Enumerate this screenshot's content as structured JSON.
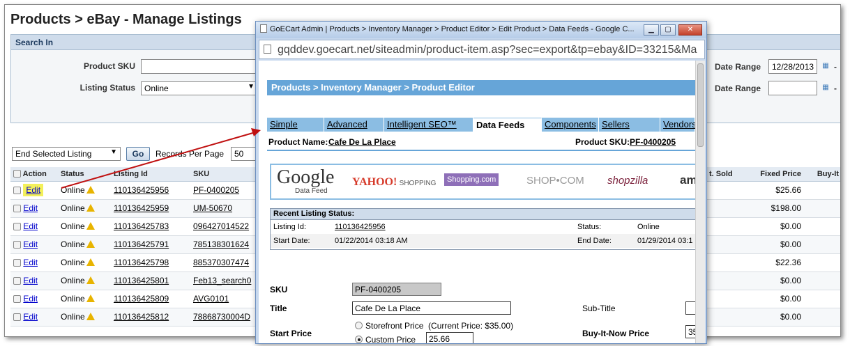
{
  "page": {
    "title": "Products > eBay - Manage Listings"
  },
  "search": {
    "header": "Search In",
    "sku_label": "Product SKU",
    "sku_value": "",
    "status_label": "Listing Status",
    "status_value": "Online",
    "date_range_label": "Date Range",
    "date_range_value": "12/28/2013",
    "date_range_label2": "Date Range",
    "date_range_value2": "",
    "dash": "-"
  },
  "bulk": {
    "action_value": "End Selected Listing",
    "go_label": "Go",
    "records_label": "Records Per Page",
    "records_value": "50"
  },
  "table": {
    "headers": {
      "action": "Action",
      "status": "Status",
      "listing_id": "Listing Id",
      "sku": "SKU",
      "sold": "t. Sold",
      "fixed_price": "Fixed Price",
      "buy_it": "Buy-It"
    },
    "rows": [
      {
        "action": "Edit",
        "status": "Online",
        "listing_id": "110136425956",
        "sku": "PF-0400205",
        "fixed_price": "$25.66"
      },
      {
        "action": "Edit",
        "status": "Online",
        "listing_id": "110136425959",
        "sku": "UM-50670",
        "fixed_price": "$198.00"
      },
      {
        "action": "Edit",
        "status": "Online",
        "listing_id": "110136425783",
        "sku": "096427014522",
        "fixed_price": "$0.00"
      },
      {
        "action": "Edit",
        "status": "Online",
        "listing_id": "110136425791",
        "sku": "785138301624",
        "fixed_price": "$0.00"
      },
      {
        "action": "Edit",
        "status": "Online",
        "listing_id": "110136425798",
        "sku": "885370307474",
        "fixed_price": "$22.36"
      },
      {
        "action": "Edit",
        "status": "Online",
        "listing_id": "110136425801",
        "sku": "Feb13_search0",
        "fixed_price": "$0.00"
      },
      {
        "action": "Edit",
        "status": "Online",
        "listing_id": "110136425809",
        "sku": "AVG0101",
        "fixed_price": "$0.00"
      },
      {
        "action": "Edit",
        "status": "Online",
        "listing_id": "110136425812",
        "sku": "78868730004D",
        "fixed_price": "$0.00"
      }
    ]
  },
  "popup": {
    "title": "GoECart Admin | Products > Inventory Manager > Product Editor > Edit Product > Data Feeds - Google C...",
    "url": "gqddev.goecart.net/siteadmin/product-item.asp?sec=export&tp=ebay&ID=33215&Ma",
    "breadcrumb": "Products > Inventory Manager > Product Editor",
    "tabs": [
      "Simple",
      "Advanced",
      "Intelligent SEO™",
      "Data Feeds",
      "Components",
      "Sellers",
      "Vendors"
    ],
    "product_name_label": "Product Name:",
    "product_name": "Cafe De La Place",
    "product_sku_label": "Product SKU:",
    "product_sku": "PF-0400205",
    "logos": {
      "google": "Google",
      "google_sub": "Data Feed",
      "yahoo": "YAHOO!",
      "yahoo_sub": "SHOPPING",
      "shopping": "Shopping.com",
      "shopcom": "SHOP•COM",
      "shopzilla": "shopzilla",
      "amazon": "am"
    },
    "recent": {
      "header": "Recent Listing Status:",
      "listing_id_label": "Listing Id:",
      "listing_id": "110136425956",
      "status_label": "Status:",
      "status": "Online",
      "start_label": "Start Date:",
      "start": "01/22/2014 03:18 AM",
      "end_label": "End Date:",
      "end": "01/29/2014 03:1"
    },
    "form": {
      "sku_label": "SKU",
      "sku_value": "PF-0400205",
      "title_label": "Title",
      "title_value": "Cafe De La Place",
      "subtitle_label": "Sub-Title",
      "start_price_label": "Start Price",
      "storefront_label": "Storefront Price",
      "current_price": "(Current Price: $35.00)",
      "custom_label": "Custom Price",
      "custom_value": "25.66",
      "buy_now_label": "Buy-It-Now Price",
      "buy_now_value": "35"
    }
  },
  "colors": {
    "accent": "#66a5d8",
    "highlight": "#f3f05a",
    "arrow": "#c01010"
  }
}
